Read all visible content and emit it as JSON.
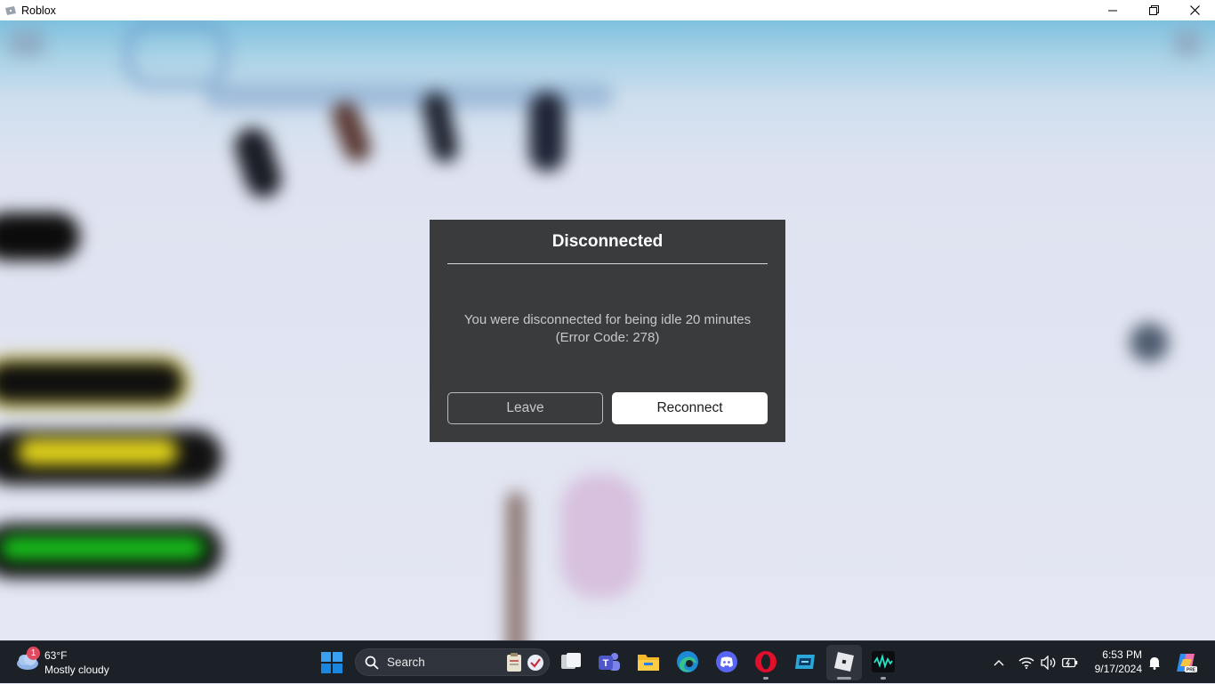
{
  "window": {
    "title": "Roblox",
    "icon": "roblox-window-icon",
    "controls": [
      "minimize-icon",
      "restore-icon",
      "close-icon"
    ]
  },
  "dialog": {
    "title": "Disconnected",
    "message_line1": "You were disconnected for being idle 20 minutes",
    "message_line2": "(Error Code: 278)",
    "leave_label": "Leave",
    "reconnect_label": "Reconnect",
    "background": "#393b3d"
  },
  "taskbar": {
    "weather": {
      "badge": "1",
      "temperature": "63°F",
      "condition": "Mostly cloudy",
      "icon": "cloud-icon"
    },
    "search_placeholder": "Search",
    "apps": [
      {
        "name": "task-view-icon"
      },
      {
        "name": "teams-icon"
      },
      {
        "name": "file-explorer-icon"
      },
      {
        "name": "edge-icon"
      },
      {
        "name": "discord-icon"
      },
      {
        "name": "opera-icon",
        "running": true
      },
      {
        "name": "app-icon"
      },
      {
        "name": "roblox-icon",
        "active": true
      },
      {
        "name": "audio-app-icon",
        "running": true
      }
    ],
    "tray_icons": [
      "chevron-up-icon",
      "wifi-icon",
      "volume-icon",
      "battery-icon"
    ],
    "time": "6:53 PM",
    "date": "9/17/2024",
    "notification_icon": "bell-icon",
    "copilot_icon": "copilot-icon"
  },
  "colors": {
    "taskbar_bg": "#1c2027",
    "accent_blue": "#0078d4",
    "sky": "#7fc1df",
    "snow": "#e4e7f3"
  }
}
